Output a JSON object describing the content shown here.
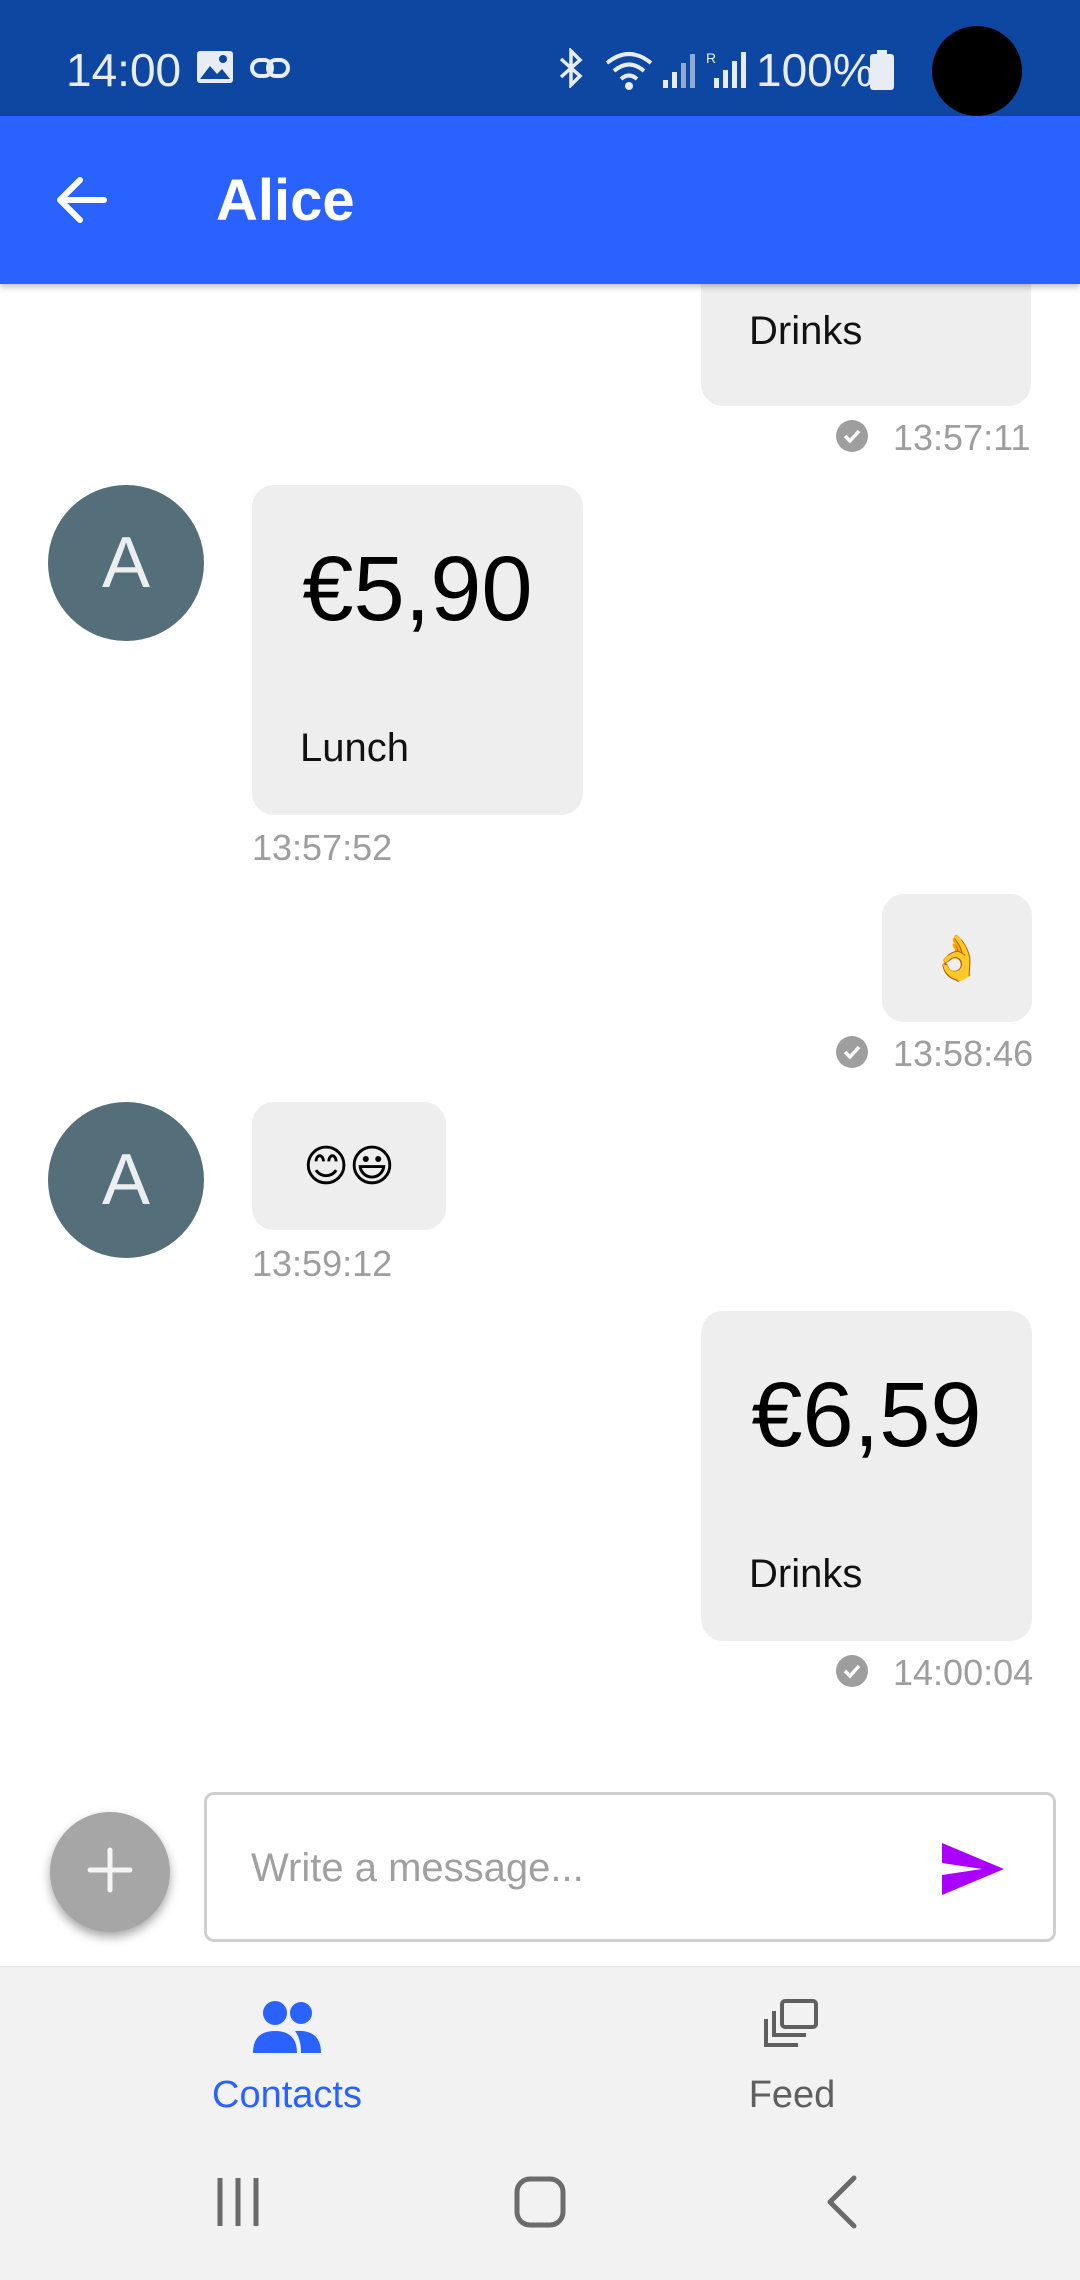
{
  "status_bar": {
    "time": "14:00",
    "battery": "100%"
  },
  "header": {
    "title": "Alice"
  },
  "messages": [
    {
      "side": "sent",
      "note": "Drinks",
      "time": "13:57:11"
    },
    {
      "side": "received",
      "avatar": "A",
      "amount": "€5,90",
      "note": "Lunch",
      "time": "13:57:52"
    },
    {
      "side": "sent",
      "emoji": "👌",
      "time": "13:58:46"
    },
    {
      "side": "received",
      "avatar": "A",
      "emoji": "😊😃",
      "time": "13:59:12"
    },
    {
      "side": "sent",
      "amount": "€6,59",
      "note": "Drinks",
      "time": "14:00:04"
    }
  ],
  "composer": {
    "placeholder": "Write a message..."
  },
  "bottom_nav": [
    {
      "label": "Contacts",
      "icon": "people-icon",
      "active": true
    },
    {
      "label": "Feed",
      "icon": "feed-icon",
      "active": false
    }
  ],
  "colors": {
    "status_bar": "#0d47a1",
    "app_bar": "#2962ff",
    "accent": "#2962ff",
    "send": "#aa00ff",
    "avatar": "#546e7a",
    "bubble": "#eeeeee"
  }
}
